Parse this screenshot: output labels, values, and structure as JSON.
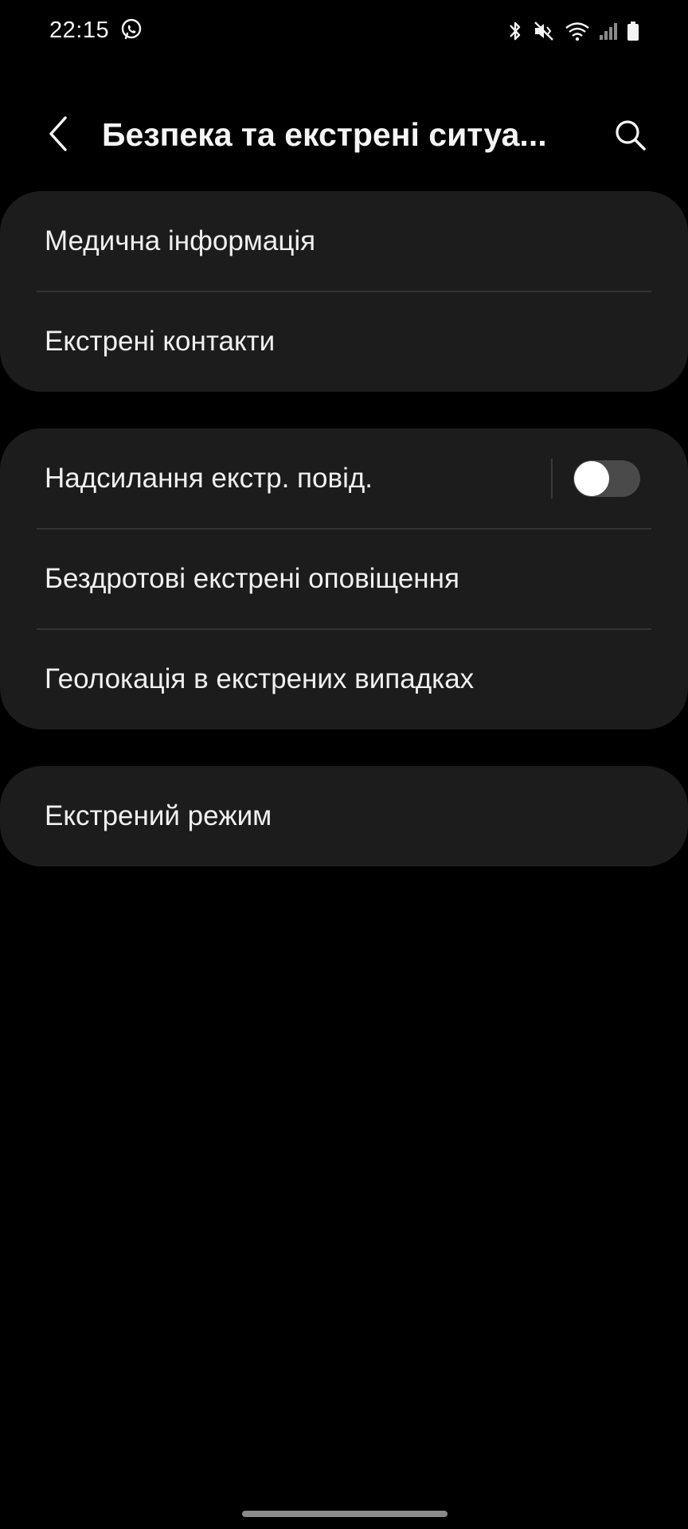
{
  "status_bar": {
    "time": "22:15",
    "icons": [
      "viber-icon",
      "bluetooth-icon",
      "mute-vibrate-icon",
      "wifi-icon",
      "signal-icon",
      "battery-icon"
    ]
  },
  "header": {
    "title": "Безпека та екстрені ситуа...",
    "back_icon": "chevron-left-icon",
    "search_icon": "search-icon"
  },
  "groups": [
    {
      "items": [
        {
          "label": "Медична інформація"
        },
        {
          "label": "Екстрені контакти"
        }
      ]
    },
    {
      "items": [
        {
          "label": "Надсилання екстр. повід.",
          "toggle": {
            "on": false
          }
        },
        {
          "label": "Бездротові екстрені оповіщення"
        },
        {
          "label": "Геолокація в екстрених випадках"
        }
      ]
    },
    {
      "items": [
        {
          "label": "Екстрений режим"
        }
      ]
    }
  ],
  "colors": {
    "background": "#000000",
    "card": "#1c1c1c",
    "divider": "#333333",
    "text": "#f0f0f0",
    "toggle_track_off": "#4a4a4a",
    "toggle_knob": "#ffffff"
  }
}
